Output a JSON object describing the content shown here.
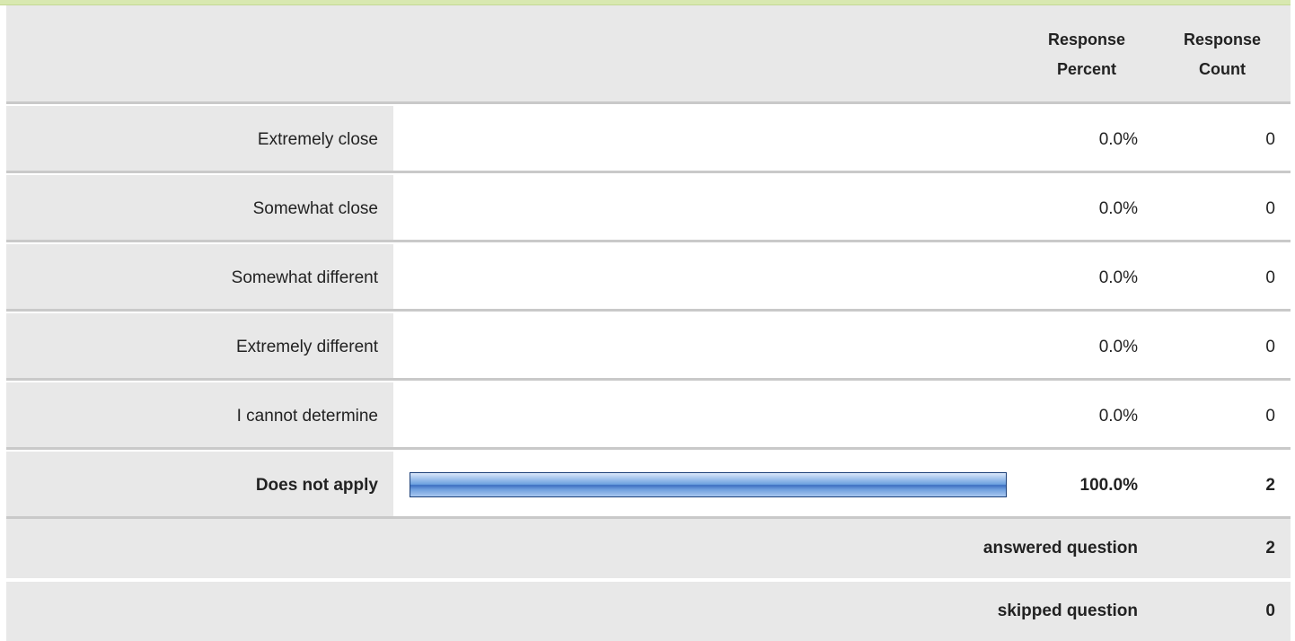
{
  "header": {
    "percent_label_line1": "Response",
    "percent_label_line2": "Percent",
    "count_label_line1": "Response",
    "count_label_line2": "Count"
  },
  "chart_data": {
    "type": "bar",
    "orientation": "horizontal",
    "categories": [
      "Extremely close",
      "Somewhat close",
      "Somewhat different",
      "Extremely different",
      "I cannot determine",
      "Does not apply"
    ],
    "percent_values": [
      0.0,
      0.0,
      0.0,
      0.0,
      0.0,
      100.0
    ],
    "count_values": [
      0,
      0,
      0,
      0,
      0,
      2
    ],
    "xlim": [
      0,
      100
    ]
  },
  "rows": [
    {
      "label": "Extremely close",
      "percent_text": "0.0%",
      "count_text": "0",
      "percent": 0,
      "highlight": false
    },
    {
      "label": "Somewhat close",
      "percent_text": "0.0%",
      "count_text": "0",
      "percent": 0,
      "highlight": false
    },
    {
      "label": "Somewhat different",
      "percent_text": "0.0%",
      "count_text": "0",
      "percent": 0,
      "highlight": false
    },
    {
      "label": "Extremely different",
      "percent_text": "0.0%",
      "count_text": "0",
      "percent": 0,
      "highlight": false
    },
    {
      "label": "I cannot determine",
      "percent_text": "0.0%",
      "count_text": "0",
      "percent": 0,
      "highlight": false
    },
    {
      "label": "Does not apply",
      "percent_text": "100.0%",
      "count_text": "2",
      "percent": 100,
      "highlight": true
    }
  ],
  "summary": {
    "answered_label": "answered question",
    "answered_value": "2",
    "skipped_label": "skipped question",
    "skipped_value": "0"
  },
  "colors": {
    "bar_border": "#1b3f78",
    "row_gray": "#e8e8e8",
    "separator": "#c9c9c9",
    "top_accent": "#d8e8b0"
  }
}
